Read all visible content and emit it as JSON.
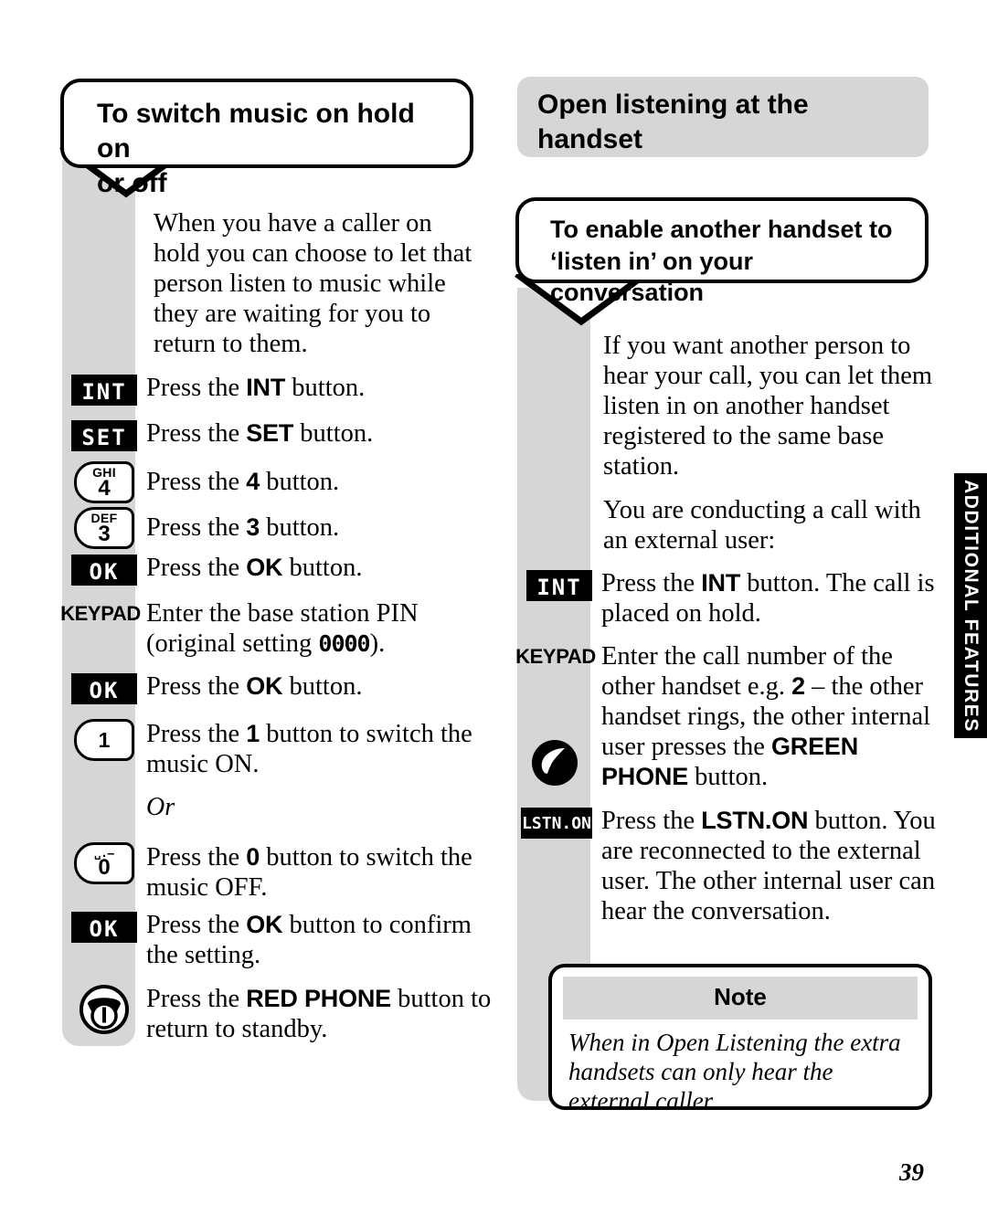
{
  "page": {
    "number": "39",
    "side_tab_label": "ADDITIONAL FEATURES",
    "accent_gray": "#d6d6d6",
    "ink": "#000000"
  },
  "left_column": {
    "callout_title_line1": "To switch music on hold on",
    "callout_title_line2": "or off",
    "intro_paragraph": "When you have a caller on hold you can choose to let that person listen to music while they are waiting for you to return to them.",
    "or_label": "Or",
    "steps": [
      {
        "icon": "int-key-icon",
        "icon_label": "INT",
        "text_html": "Press the <b>INT</b> button."
      },
      {
        "icon": "set-key-icon",
        "icon_label": "SET",
        "text_html": "Press the <b>SET</b> button."
      },
      {
        "icon": "numkey-4-icon",
        "icon_label": "4",
        "icon_letters": "GHI",
        "text_html": "Press the <b>4</b> button."
      },
      {
        "icon": "numkey-3-icon",
        "icon_label": "3",
        "icon_letters": "DEF",
        "text_html": "Press the <b>3</b> button."
      },
      {
        "icon": "ok-key-icon",
        "icon_label": "OK",
        "text_html": "Press the <b>OK</b> button."
      },
      {
        "icon": "keypad-icon",
        "icon_label": "KEYPAD",
        "text_html": "Enter the base station PIN (original setting <span class=\"lcd\">0000</span>)."
      },
      {
        "icon": "ok-key-icon",
        "icon_label": "OK",
        "text_html": "Press the <b>OK</b> button."
      },
      {
        "icon": "numkey-1-icon",
        "icon_label": "1",
        "icon_letters": "",
        "text_html": "Press the <b>1</b> button to switch the music ON."
      },
      {
        "icon": "numkey-0-icon",
        "icon_label": "0",
        "icon_letters": "␣.–",
        "text_html": "Press the <b>0</b> button to switch the music OFF."
      },
      {
        "icon": "ok-key-icon",
        "icon_label": "OK",
        "text_html": "Press the <b>OK</b> button to confirm the setting."
      },
      {
        "icon": "red-phone-icon",
        "icon_label": "",
        "text_html": "Press the <b>RED PHONE</b> button to return to standby."
      }
    ]
  },
  "right_column": {
    "banner_title_line1": "Open listening at the",
    "banner_title_line2": "handset",
    "callout_title_line1": "To enable another handset to",
    "callout_title_line2": "‘listen in’ on your conversation",
    "intro_paragraph": "If you want another person to hear your call, you can let them listen in on another handset registered to the same base station.",
    "lead_paragraph": "You are conducting a call with an external user:",
    "steps": [
      {
        "icon": "int-key-icon",
        "icon_label": "INT",
        "text_html": "Press the <b>INT</b> button. The call is placed on hold."
      },
      {
        "icon": "keypad-icon",
        "icon_label": "KEYPAD",
        "text_html": "Enter the call number of the other handset e.g. <b>2</b> – the other handset rings, the other internal user presses the <b>GREEN PHONE</b> button."
      },
      {
        "icon": "green-phone-icon",
        "icon_label": "",
        "text_html": ""
      },
      {
        "icon": "lstn-on-key-icon",
        "icon_label": "LSTN.ON",
        "text_html": "Press the <b>LSTN.ON</b> button. You are reconnected to the external user. The other internal user can hear the conversation."
      }
    ],
    "note": {
      "heading": "Note",
      "body": "When in Open Listening the extra handsets can only hear the external caller."
    }
  }
}
